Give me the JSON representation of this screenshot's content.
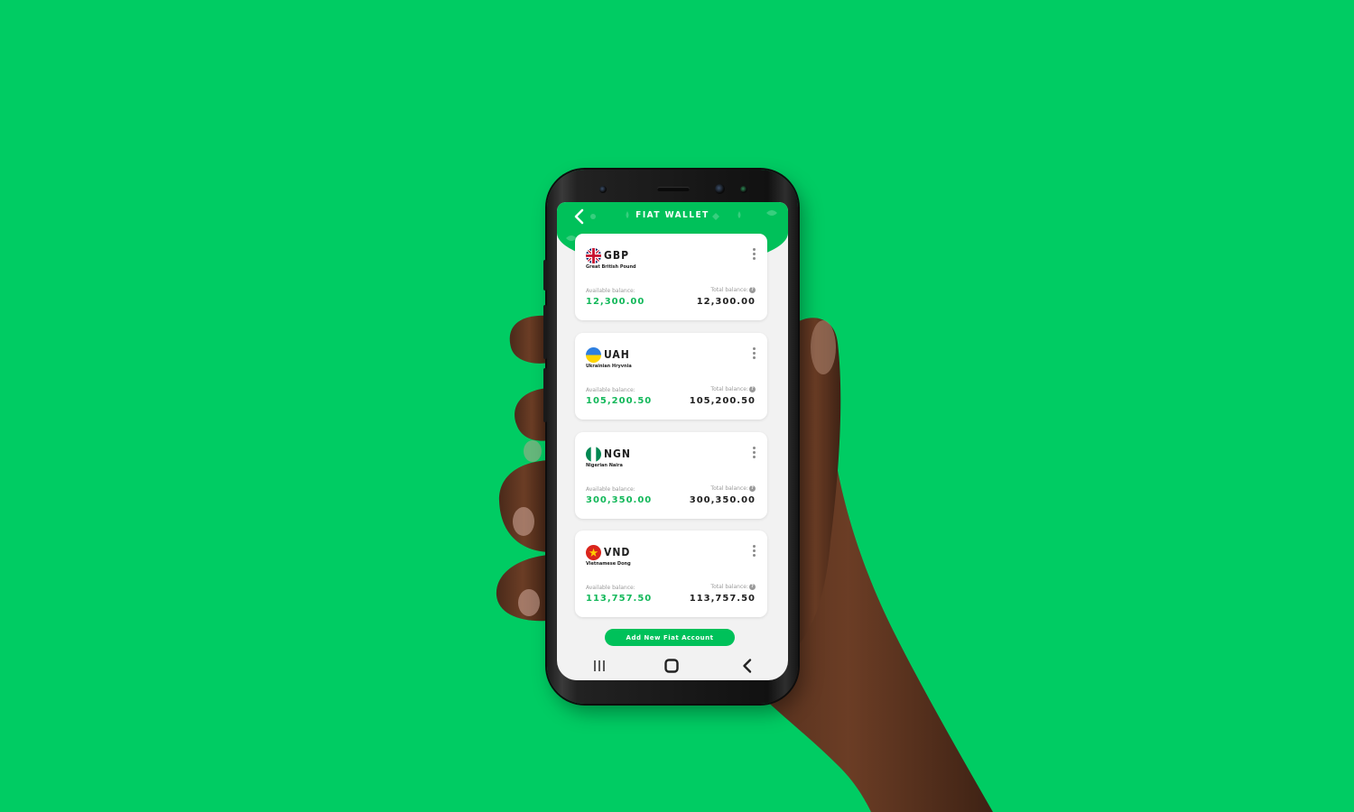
{
  "app": {
    "title": "FIAT WALLET",
    "accent_color": "#00c15a",
    "background_color": "#00cc63"
  },
  "header": {
    "back_icon": "chevron-left-icon"
  },
  "wallets": [
    {
      "code": "GBP",
      "name": "Great British Pound",
      "flag": "uk-flag-icon",
      "available_label": "Available balance:",
      "available": "12,300.00",
      "total_label": "Total balance:",
      "total": "12,300.00"
    },
    {
      "code": "UAH",
      "name": "Ukrainian Hryvnia",
      "flag": "ukraine-flag-icon",
      "available_label": "Available balance:",
      "available": "105,200.50",
      "total_label": "Total balance:",
      "total": "105,200.50"
    },
    {
      "code": "NGN",
      "name": "Nigerian Naira",
      "flag": "nigeria-flag-icon",
      "available_label": "Available balance:",
      "available": "300,350.00",
      "total_label": "Total balance:",
      "total": "300,350.00"
    },
    {
      "code": "VND",
      "name": "Vietnamese Dong",
      "flag": "vietnam-flag-icon",
      "available_label": "Available balance:",
      "available": "113,757.50",
      "total_label": "Total balance:",
      "total": "113,757.50"
    }
  ],
  "actions": {
    "add_account_label": "Add New Fiat Account"
  },
  "navbar": {
    "recents_icon": "recent-apps-icon",
    "home_icon": "home-icon",
    "back_icon": "back-icon"
  }
}
